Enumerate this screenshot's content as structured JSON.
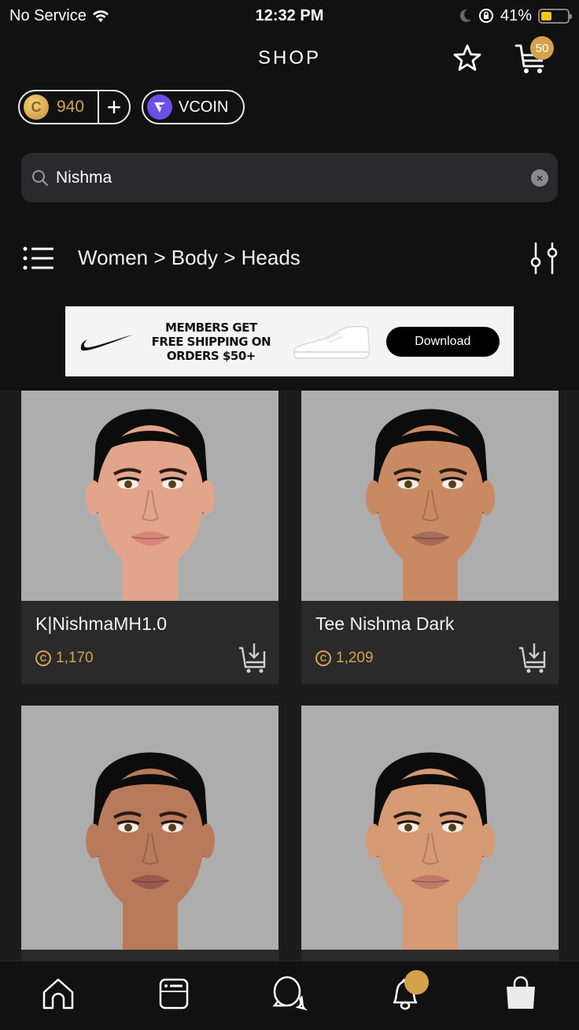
{
  "status_bar": {
    "carrier": "No Service",
    "time": "12:32 PM",
    "battery_percent": "41%",
    "battery_level": 0.41
  },
  "header": {
    "title": "SHOP",
    "cart_count": "50"
  },
  "currency": {
    "coins": "940",
    "add_symbol": "+",
    "vcoin_label": "VCOIN",
    "coin_symbol": "C"
  },
  "search": {
    "value": "Nishma",
    "clear_symbol": "×"
  },
  "breadcrumb": {
    "path": "Women > Body > Heads"
  },
  "ad": {
    "headline_line1": "MEMBERS GET",
    "headline_line2": "FREE SHIPPING ON",
    "headline_line3": "ORDERS $50+",
    "cta": "Download"
  },
  "products": [
    {
      "name": "K|NishmaMH1.0",
      "price": "1,170",
      "skin": "#e2a48a",
      "lip": "#d9857a"
    },
    {
      "name": "Tee Nishma Dark",
      "price": "1,209",
      "skin": "#c98a63",
      "lip": "#a86a5a"
    },
    {
      "name": "",
      "price": "",
      "skin": "#b87a5a",
      "lip": "#9a5a4f"
    },
    {
      "name": "",
      "price": "",
      "skin": "#d69a74",
      "lip": "#c07a6a"
    }
  ],
  "bottom_nav": {
    "items": [
      "home",
      "feed",
      "chat",
      "notifications",
      "shop"
    ]
  },
  "colors": {
    "accent_gold": "#d4a24c",
    "vcoin_purple": "#6e4ee6",
    "background": "#111111"
  }
}
